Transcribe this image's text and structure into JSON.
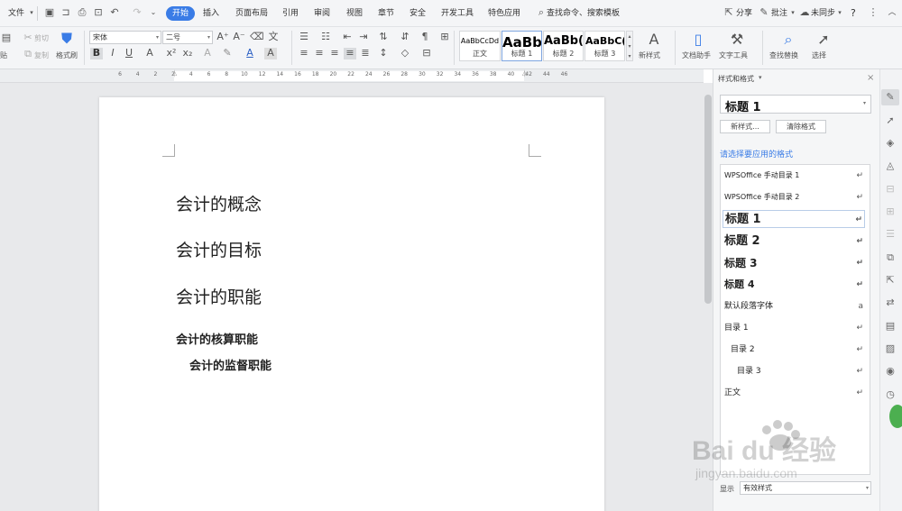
{
  "menubar": {
    "file_label": "文件",
    "tabs": [
      "开始",
      "插入",
      "页面布局",
      "引用",
      "审阅",
      "视图",
      "章节",
      "安全",
      "开发工具",
      "特色应用"
    ],
    "active_tab": "开始",
    "search_label": "查找命令、搜索模板",
    "share_label": "分享",
    "comment_label": "批注",
    "sync_label": "未同步",
    "help_label": "?"
  },
  "ribbon": {
    "paste_label": "贴",
    "cut_label": "剪切",
    "copy_label": "复制",
    "format_painter_label": "格式刷",
    "font_name": "宋体",
    "font_size": "二号",
    "styles": [
      {
        "sample": "AaBbCcDd",
        "label": "正文"
      },
      {
        "sample": "AaBb",
        "label": "标题 1"
      },
      {
        "sample": "AaBb(",
        "label": "标题 2"
      },
      {
        "sample": "AaBbC(",
        "label": "标题 3"
      }
    ],
    "new_style_label": "新样式",
    "doc_assistant_label": "文档助手",
    "text_tools_label": "文字工具",
    "find_replace_label": "查找替换",
    "select_label": "选择",
    "accent": "#3a7ce6"
  },
  "ruler": {
    "ticks": [
      "6",
      "4",
      "2",
      "2",
      "4",
      "6",
      "8",
      "10",
      "12",
      "14",
      "16",
      "18",
      "20",
      "22",
      "24",
      "26",
      "28",
      "30",
      "32",
      "34",
      "36",
      "38",
      "40",
      "42",
      "44",
      "46"
    ]
  },
  "document": {
    "headings": [
      "会计的概念",
      "会计的目标",
      "会计的职能"
    ],
    "subheadings": [
      "会计的核算职能",
      "会计的监督职能"
    ]
  },
  "pane": {
    "title": "样式和格式",
    "current_style": "标题  1",
    "new_style_button": "新样式...",
    "clear_format_button": "清除格式",
    "apply_label": "请选择要应用的格式",
    "styles": [
      "WPSOffice 手动目录 1",
      "WPSOffice 手动目录 2",
      "标题  1",
      "标题  2",
      "标题  3",
      "标题  4",
      "默认段落字体",
      "目录  1",
      "目录  2",
      "目录  3",
      "正文"
    ],
    "show_label": "显示",
    "show_value": "有效样式"
  },
  "watermark": {
    "logo_text": "Bai du 经验",
    "url_text": "jingyan.baidu.com"
  }
}
